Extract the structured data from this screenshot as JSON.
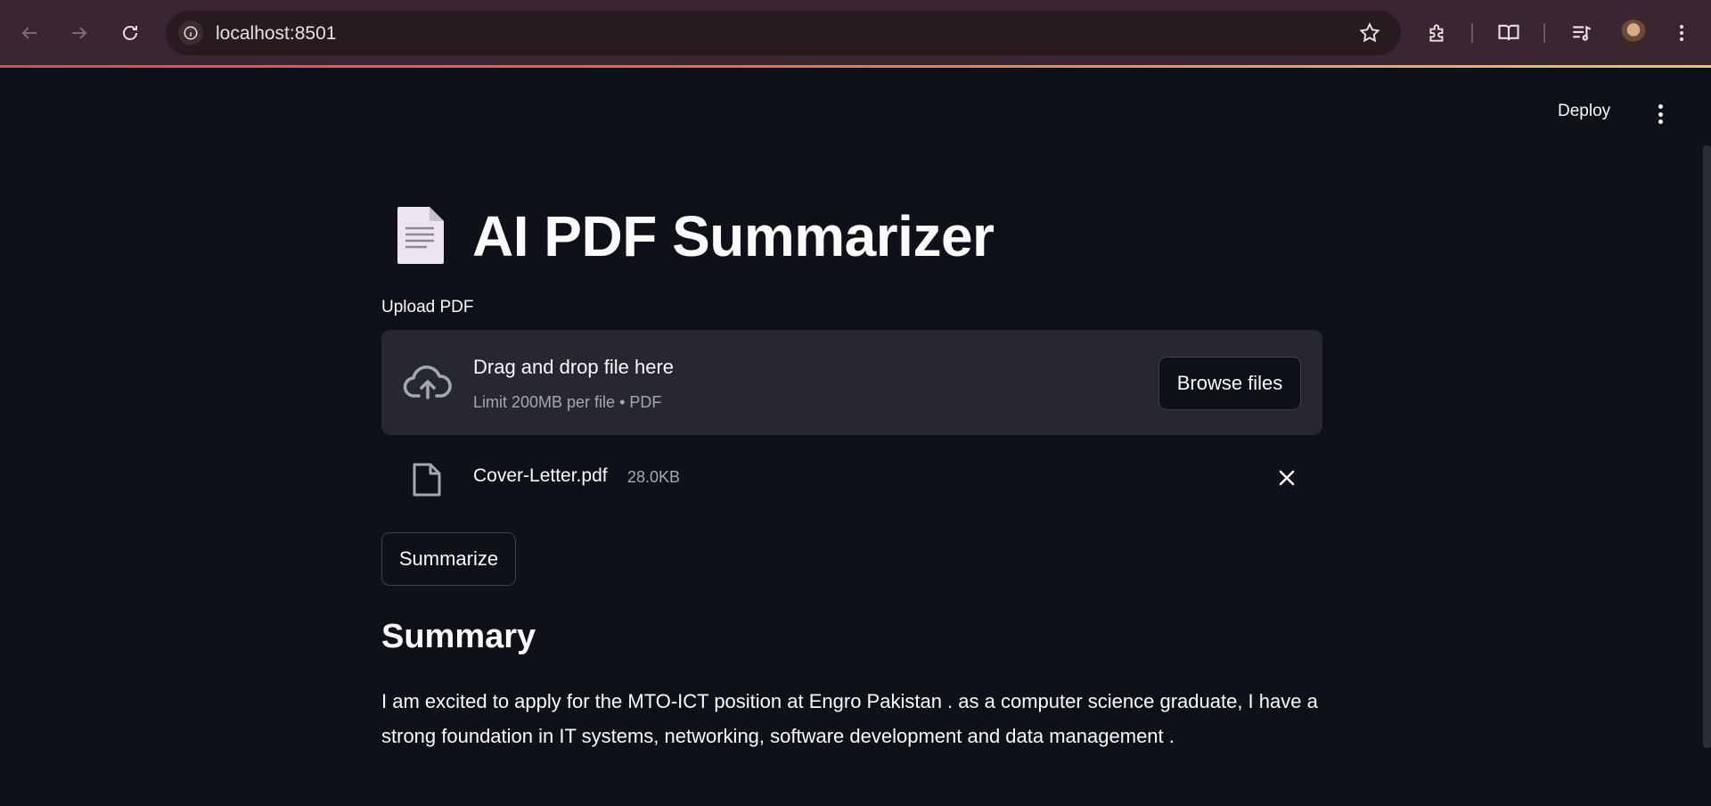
{
  "browser": {
    "url": "localhost:8501"
  },
  "header": {
    "deploy_label": "Deploy"
  },
  "main": {
    "title": "AI PDF Summarizer",
    "uploader": {
      "label": "Upload PDF",
      "drop_text": "Drag and drop file here",
      "limit_text": "Limit 200MB per file • PDF",
      "browse_label": "Browse files"
    },
    "file": {
      "name": "Cover-Letter.pdf",
      "size": "28.0KB"
    },
    "summarize_label": "Summarize",
    "summary": {
      "heading": "Summary",
      "text": "I am excited to apply for the MTO-ICT position at Engro Pakistan . as a computer science graduate, I have a strong foundation in IT systems, networking, software development and data management ."
    }
  },
  "icons": {
    "back": "arrow-left-icon",
    "forward": "arrow-right-icon",
    "reload": "reload-icon",
    "site_info": "site-info-icon",
    "bookmark": "star-icon",
    "extensions": "puzzle-icon",
    "reading_mode": "book-icon",
    "media": "playlist-icon",
    "menu": "kebab-menu-icon",
    "upload": "cloud-upload-icon",
    "file": "file-icon",
    "remove": "close-icon"
  },
  "colors": {
    "background": "#0e1117",
    "dropzone": "#262730",
    "chrome": "#3a2630",
    "muted_text": "#a3a8b8"
  }
}
